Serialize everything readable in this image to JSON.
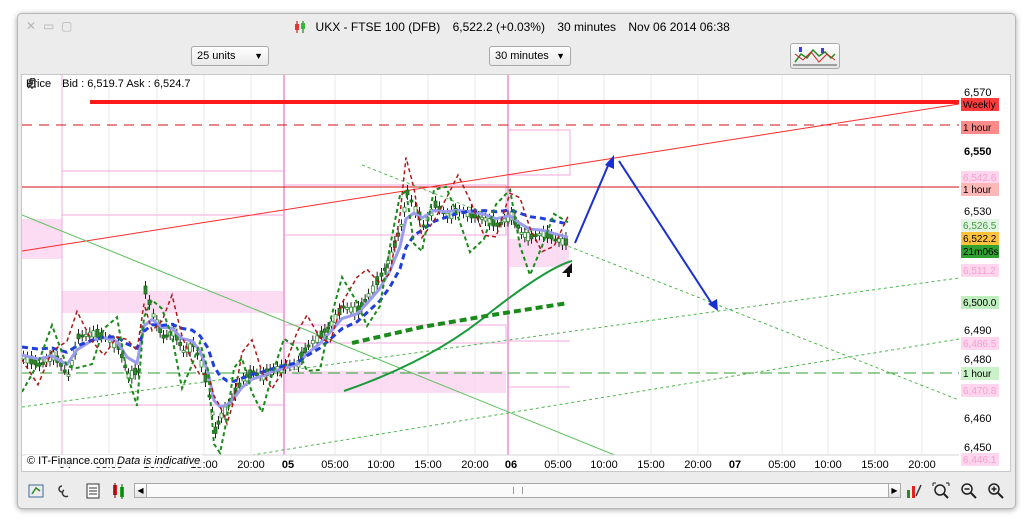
{
  "window": {
    "instrument": "UKX - FTSE 100 (DFB)",
    "price_change": "6,522.2 (+0.03%)",
    "timeframe": "30 minutes",
    "datetime": "Nov 06 2014 06:38"
  },
  "toolbar": {
    "units_value": "25 units",
    "timeframe_value": "30 minutes"
  },
  "chart": {
    "price_label": "Price",
    "bid_ask": "Bid : 6,519.7  Ask : 6,524.7",
    "copyright": "© IT-Finance.com",
    "indicative": "Data is indicative",
    "axis_labels": [
      "6,570",
      "6,550",
      "6,530",
      "6,490",
      "6,480",
      "6,460",
      "6,450"
    ],
    "tags": [
      {
        "text": "Weekly",
        "bg": "#ff3b3b",
        "fg": "#000000"
      },
      {
        "text": "1 hour",
        "bg": "#ff8a8a",
        "fg": "#000000"
      },
      {
        "text": "6,542.6",
        "bg": "#ffd6ee",
        "fg": "#f6a0d0"
      },
      {
        "text": "1 hour",
        "bg": "#ffb8b8",
        "fg": "#000000"
      },
      {
        "text": "6,526.5",
        "bg": "#e4f4e4",
        "fg": "#3a9a3a"
      },
      {
        "text": "6,522.2",
        "bg": "#ffc23a",
        "fg": "#000000"
      },
      {
        "text": "21m06s",
        "bg": "#2fa22f",
        "fg": "#000000"
      },
      {
        "text": "6,511.2",
        "bg": "#ffd6ee",
        "fg": "#f6a0d0"
      },
      {
        "text": "6,500.0",
        "bg": "#bfeebf",
        "fg": "#000000"
      },
      {
        "text": "6,486.5",
        "bg": "#ffd6ee",
        "fg": "#f6a0d0"
      },
      {
        "text": "1 hour",
        "bg": "#c9f2c9",
        "fg": "#000000"
      },
      {
        "text": "6,470.8",
        "bg": "#ffd6ee",
        "fg": "#f6a0d0"
      },
      {
        "text": "6,446.1",
        "bg": "#ffd6ee",
        "fg": "#f6a0d0"
      }
    ],
    "time_labels": [
      "04",
      "05:00",
      "10:00",
      "15:00",
      "20:00",
      "05",
      "05:00",
      "10:00",
      "15:00",
      "20:00",
      "06",
      "05:00",
      "10:00",
      "15:00",
      "20:00",
      "07",
      "05:00",
      "10:00",
      "15:00",
      "20:00"
    ]
  },
  "colors": {
    "red_line": "#ff1a1a",
    "pink_zone": "#fbd0ee",
    "green": "#2da02d",
    "blue_dash": "#1f3fdc",
    "lavender": "#9b9bee",
    "arrow": "#1a2fd0"
  },
  "icons": {
    "bottom": [
      "crosshair-icon",
      "link-icon",
      "list-icon",
      "candles-icon",
      "draw-icon",
      "zoom-fit-icon",
      "zoom-out-icon",
      "zoom-in-icon"
    ]
  }
}
